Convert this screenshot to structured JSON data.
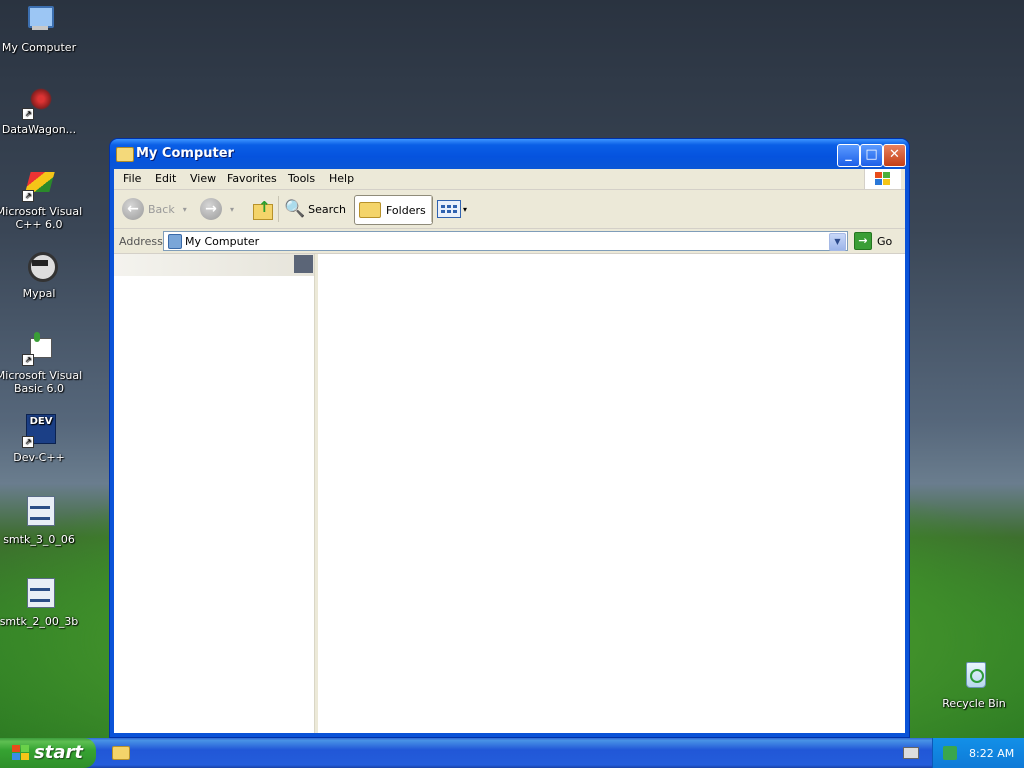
{
  "desktop": {
    "icons": [
      {
        "label": "My Computer"
      },
      {
        "label": "DataWagon..."
      },
      {
        "label": "Microsoft Visual C++ 6.0"
      },
      {
        "label": "Mypal"
      },
      {
        "label": "Microsoft Visual Basic 6.0"
      },
      {
        "label": "Dev-C++",
        "glyph_text": "DEV"
      },
      {
        "label": "smtk_3_0_06"
      },
      {
        "label": "smtk_2_00_3b"
      },
      {
        "label": "Recycle Bin"
      }
    ]
  },
  "window": {
    "title": "My Computer",
    "menu": [
      "File",
      "Edit",
      "View",
      "Favorites",
      "Tools",
      "Help"
    ],
    "toolbar": {
      "back_label": "Back",
      "search_label": "Search",
      "folders_label": "Folders"
    },
    "address": {
      "label": "Address",
      "value": "My Computer",
      "go_label": "Go"
    }
  },
  "taskbar": {
    "start_label": "start",
    "clock": "8:22 AM"
  },
  "colors": {
    "title_blue": "#0a53d8",
    "taskbar_blue": "#245ddb",
    "start_green": "#36a332",
    "tray_blue": "#0f7ad7"
  }
}
